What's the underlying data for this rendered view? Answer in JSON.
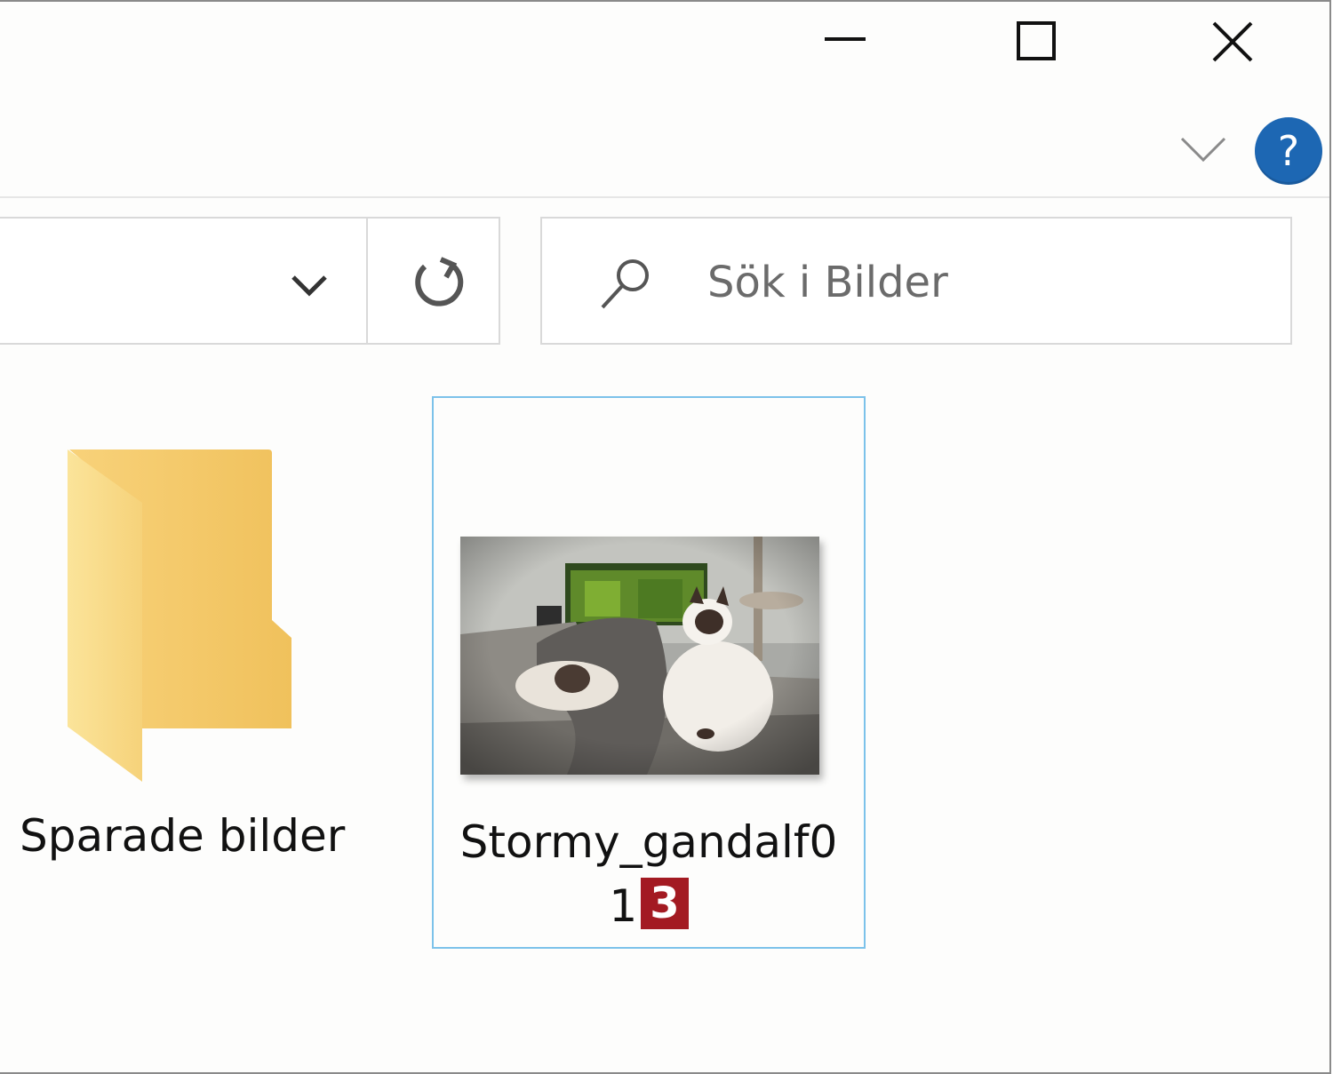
{
  "window": {
    "controls": {
      "minimize_icon": "minimize-icon",
      "maximize_icon": "maximize-icon",
      "close_icon": "close-icon"
    },
    "ribbon": {
      "expand_icon": "chevron-down-icon",
      "help_label": "?"
    }
  },
  "toolbar": {
    "address_dropdown_icon": "chevron-down-icon",
    "refresh_icon": "refresh-icon",
    "search": {
      "placeholder": "Sök i Bilder",
      "value": ""
    }
  },
  "content": {
    "items": [
      {
        "type": "folder",
        "label": "Sparade bilder",
        "icon": "folder-icon"
      },
      {
        "type": "image",
        "label_line1": "Stormy_gandalf0",
        "label_line2": "1",
        "selected": true,
        "thumbnail": "cat-photo-thumbnail"
      }
    ],
    "callout_badge": "3"
  },
  "colors": {
    "selection_border": "#7cc2ea",
    "help_button": "#1d67b3",
    "badge": "#a31a22",
    "folder": "#f5c86a"
  }
}
